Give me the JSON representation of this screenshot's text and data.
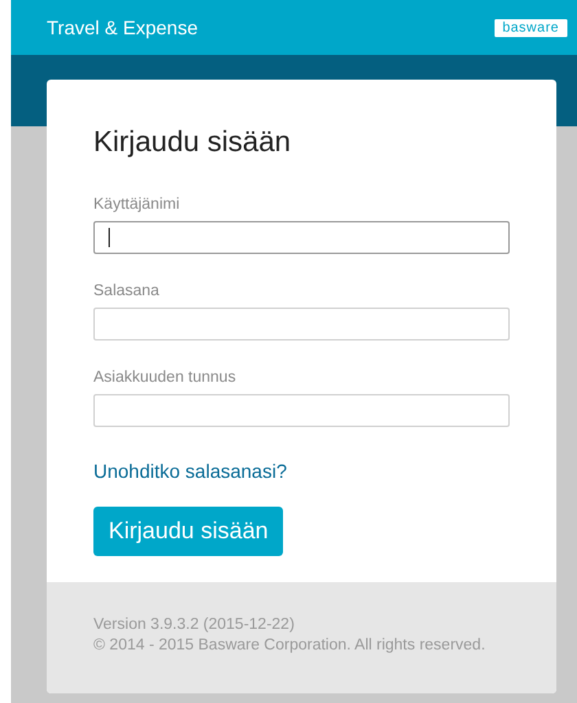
{
  "header": {
    "title": "Travel & Expense",
    "logo": "basware"
  },
  "login": {
    "heading": "Kirjaudu sisään",
    "fields": [
      {
        "label": "Käyttäjänimi",
        "focused": true
      },
      {
        "label": "Salasana",
        "focused": false
      },
      {
        "label": "Asiakkuuden tunnus",
        "focused": false
      }
    ],
    "forgot_link": "Unohditko salasanasi?",
    "submit": "Kirjaudu sisään"
  },
  "footer": {
    "version": "Version 3.9.3.2 (2015-12-22)",
    "copyright": "© 2014 - 2015 Basware Corporation. All rights reserved."
  }
}
